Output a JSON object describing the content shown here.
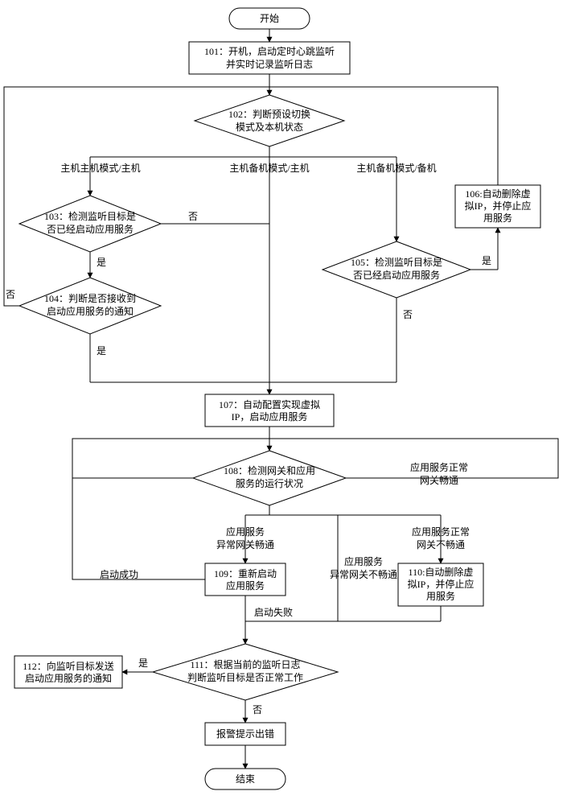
{
  "nodes": {
    "start": "开始",
    "n101_l1": "101：开机，启动定时心跳监听",
    "n101_l2": "并实时记录监听日志",
    "n102_l1": "102：判断预设切换",
    "n102_l2": "模式及本机状态",
    "n103_l1": "103：检测监听目标是",
    "n103_l2": "否已经启动应用服务",
    "n104_l1": "104：判断是否接收到",
    "n104_l2": "启动应用服务的通知",
    "n105_l1": "105：检测监听目标是",
    "n105_l2": "否已经启动应用服务",
    "n106_l1": "106:自动删除虚",
    "n106_l2": "拟IP，并停止应",
    "n106_l3": "用服务",
    "n107_l1": "107：自动配置实现虚拟",
    "n107_l2": "IP，启动应用服务",
    "n108_l1": "108：检测网关和应用",
    "n108_l2": "服务的运行状况",
    "n109_l1": "109：重新启动",
    "n109_l2": "应用服务",
    "n110_l1": "110:自动删除虚",
    "n110_l2": "拟IP，并停止应",
    "n110_l3": "用服务",
    "n111_l1": "111：根据当前的监听日志",
    "n111_l2": "判断监听目标是否正常工作",
    "n112_l1": "112：向监听目标发送",
    "n112_l2": "启动应用服务的通知",
    "alarm": "报警提示出错",
    "end": "结束"
  },
  "edges": {
    "branch1": "主机主机模式/主机",
    "branch2": "主机备机模式/主机",
    "branch3": "主机备机模式/备机",
    "yes": "是",
    "no": "否",
    "svc_ok_gw_ok_l1": "应用服务正常",
    "svc_ok_gw_ok_l2": "网关畅通",
    "svc_ok_gw_bad_l1": "应用服务正常",
    "svc_ok_gw_bad_l2": "网关不畅通",
    "svc_bad_gw_ok_l1": "应用服务",
    "svc_bad_gw_ok_l2": "异常网关畅通",
    "svc_bad_gw_bad_l1": "应用服务",
    "svc_bad_gw_bad_l2": "异常网关不畅通",
    "restart_ok": "启动成功",
    "restart_fail": "启动失败"
  }
}
